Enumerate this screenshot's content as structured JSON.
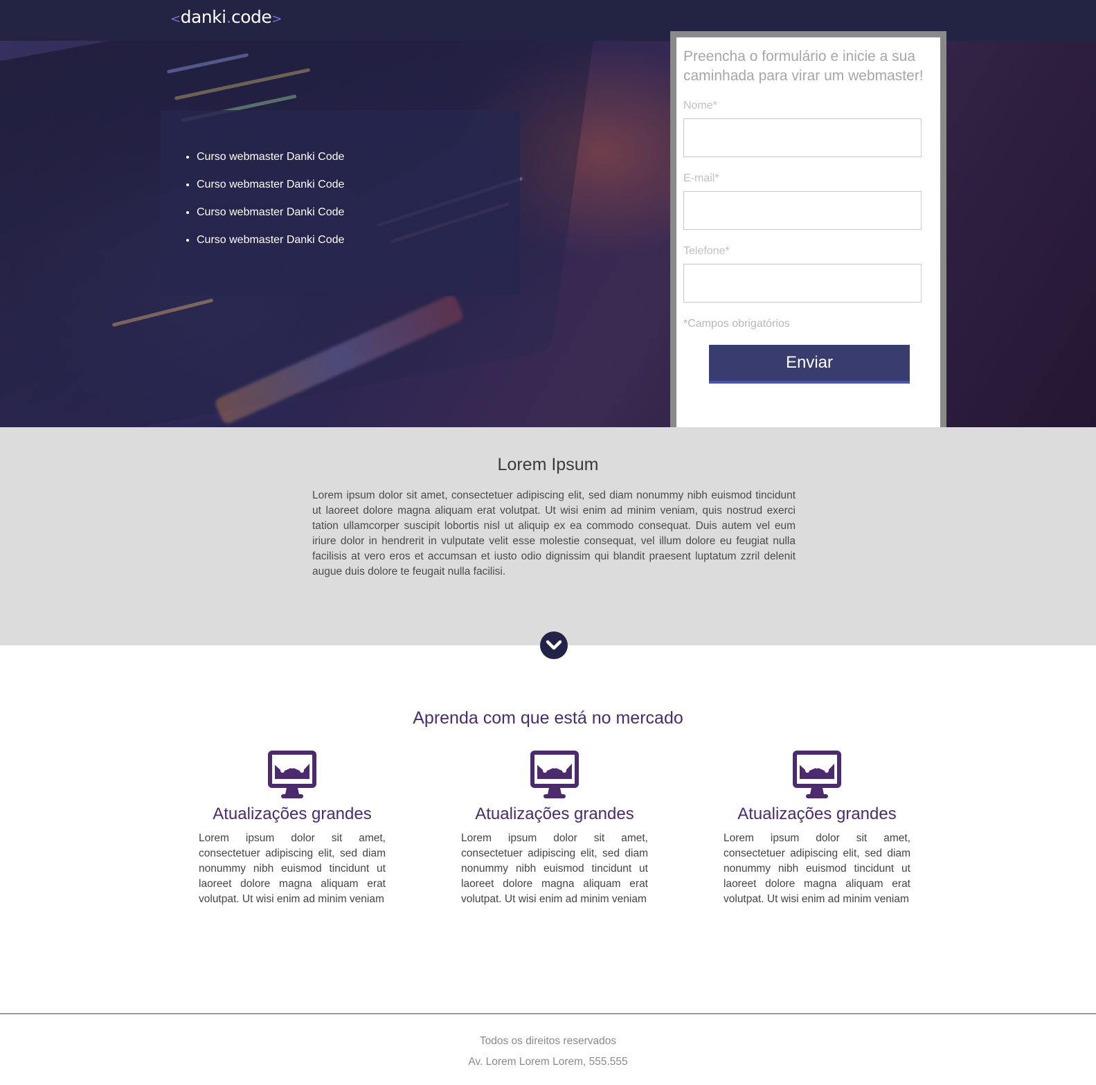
{
  "header": {
    "logo_open": "<",
    "logo_name": "danki",
    "logo_dot": ".",
    "logo_code": "code",
    "logo_close": ">"
  },
  "hero": {
    "list": [
      "Curso webmaster Danki Code",
      "Curso webmaster Danki Code",
      "Curso webmaster Danki Code",
      "Curso webmaster Danki Code"
    ]
  },
  "form": {
    "title": "Preencha o formulário e inicie a sua caminhada para virar um webmaster!",
    "name_label": "Nome*",
    "email_label": "E-mail*",
    "phone_label": "Telefone*",
    "name_value": "",
    "email_value": "",
    "phone_value": "",
    "required_note": "*Campos obrigatórios",
    "submit_label": "Enviar"
  },
  "about": {
    "title": "Lorem Ipsum",
    "text": "Lorem ipsum dolor sit amet, consectetuer adipiscing elit, sed diam nonummy nibh euismod tincidunt ut laoreet dolore magna aliquam erat volutpat. Ut wisi enim ad minim veniam, quis nostrud exerci tation ullamcorper suscipit lobortis nisl ut aliquip ex ea commodo consequat. Duis autem vel eum iriure dolor in hendrerit in vulputate velit esse molestie consequat, vel illum dolore eu feugiat nulla facilisis at vero eros et accumsan et iusto odio dignissim qui blandit praesent luptatum zzril delenit augue duis dolore te feugait nulla facilisi."
  },
  "features": {
    "title": "Aprenda com que está no mercado",
    "icon": "monitor-chart-icon",
    "items": [
      {
        "title": "Atualizações grandes",
        "text": "Lorem ipsum dolor sit amet, consectetuer adipiscing elit, sed diam nonummy nibh euismod tincidunt ut laoreet dolore magna aliquam erat volutpat. Ut wisi enim ad minim veniam"
      },
      {
        "title": "Atualizações grandes",
        "text": "Lorem ipsum dolor sit amet, consectetuer adipiscing elit, sed diam nonummy nibh euismod tincidunt ut laoreet dolore magna aliquam erat volutpat. Ut wisi enim ad minim veniam"
      },
      {
        "title": "Atualizações grandes",
        "text": "Lorem ipsum dolor sit amet, consectetuer adipiscing elit, sed diam nonummy nibh euismod tincidunt ut laoreet dolore magna aliquam erat volutpat. Ut wisi enim ad minim veniam"
      }
    ]
  },
  "footer": {
    "rights": "Todos os direitos reservados",
    "address": "Av. Lorem Lorem Lorem, 555.555"
  },
  "colors": {
    "header_bg": "#232343",
    "accent_purple": "#4b2b6e",
    "button_bg": "#393c6f",
    "section_gray": "#dcdcdc"
  }
}
